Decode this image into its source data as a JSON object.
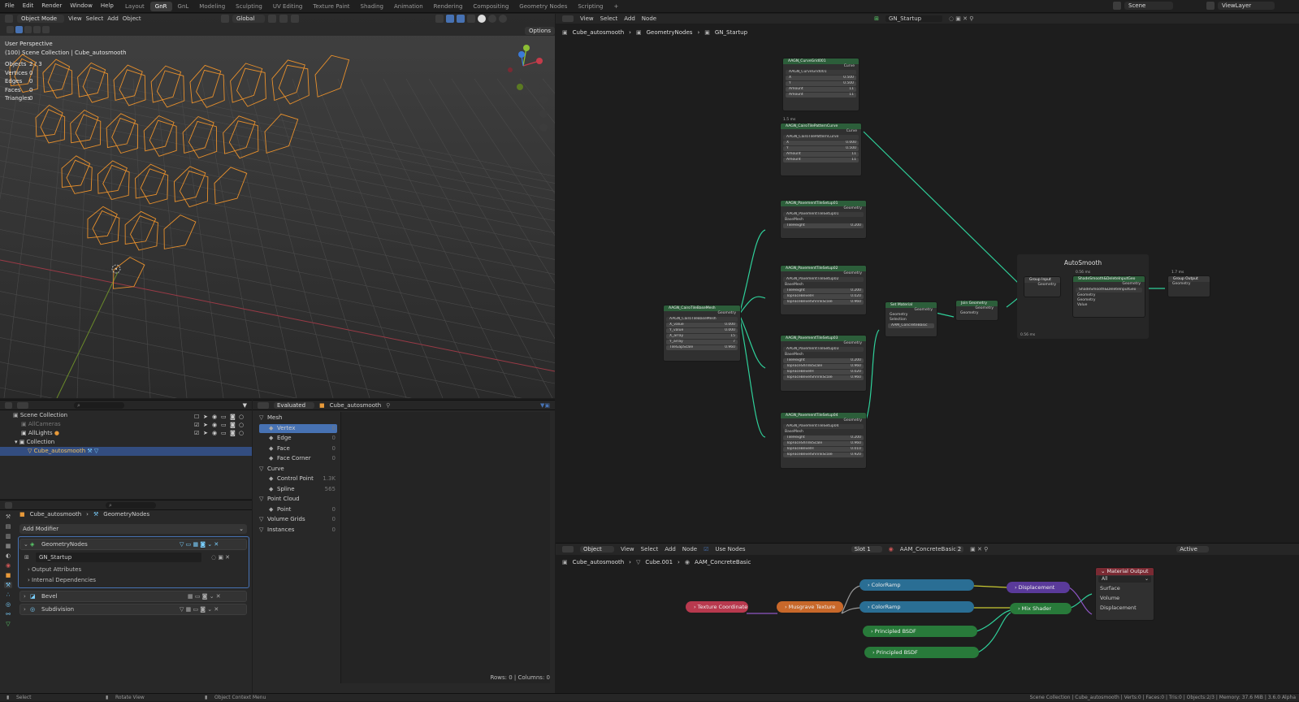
{
  "topbar": {
    "menus": [
      "File",
      "Edit",
      "Render",
      "Window",
      "Help"
    ],
    "workspaces": [
      "Layout",
      "GnR",
      "GnL",
      "Modeling",
      "Sculpting",
      "UV Editing",
      "Texture Paint",
      "Shading",
      "Animation",
      "Rendering",
      "Compositing",
      "Geometry Nodes",
      "Scripting",
      "+"
    ],
    "active_workspace": "GnR",
    "scene": "Scene",
    "view_layer": "ViewLayer"
  },
  "viewport": {
    "mode": "Object Mode",
    "menus": [
      "View",
      "Select",
      "Add",
      "Object"
    ],
    "transform": "Global",
    "options_label": "Options",
    "perspective": "User Perspective",
    "collection_line": "(100) Scene Collection | Cube_autosmooth",
    "stats": [
      {
        "label": "Objects",
        "value": "2 / 3"
      },
      {
        "label": "Vertices",
        "value": "0"
      },
      {
        "label": "Edges",
        "value": "0"
      },
      {
        "label": "Faces",
        "value": "0"
      },
      {
        "label": "Triangles",
        "value": "0"
      }
    ],
    "mesh_color": "#e8902c"
  },
  "outliner": {
    "items": [
      {
        "label": "Scene Collection",
        "indent": 0
      },
      {
        "label": "AllCameras",
        "indent": 1
      },
      {
        "label": "AllLights",
        "indent": 1
      },
      {
        "label": "Collection",
        "indent": 1
      },
      {
        "label": "Cube_autosmooth",
        "indent": 2
      }
    ]
  },
  "properties": {
    "breadcrumb": [
      "Cube_autosmooth",
      "GeometryNodes"
    ],
    "add_modifier": "Add Modifier",
    "modifiers": [
      {
        "name": "GeometryNodes",
        "node_group": "GN_Startup",
        "subitems": [
          "Output Attributes",
          "Internal Dependencies"
        ]
      },
      {
        "name": "Bevel"
      },
      {
        "name": "Subdivision"
      }
    ]
  },
  "spreadsheet": {
    "mode": "Evaluated",
    "object": "Cube_autosmooth",
    "rows": [
      {
        "label": "Mesh",
        "count": "",
        "group": true
      },
      {
        "label": "Vertex",
        "count": "0",
        "group": false,
        "active": true
      },
      {
        "label": "Edge",
        "count": "0",
        "group": false
      },
      {
        "label": "Face",
        "count": "0",
        "group": false
      },
      {
        "label": "Face Corner",
        "count": "0",
        "group": false
      },
      {
        "label": "Curve",
        "count": "",
        "group": true
      },
      {
        "label": "Control Point",
        "count": "1.3K",
        "group": false
      },
      {
        "label": "Spline",
        "count": "565",
        "group": false
      },
      {
        "label": "Point Cloud",
        "count": "",
        "group": true
      },
      {
        "label": "Point",
        "count": "0",
        "group": false
      },
      {
        "label": "Volume Grids",
        "count": "0",
        "group": true
      },
      {
        "label": "Instances",
        "count": "0",
        "group": true
      }
    ],
    "footer": "Rows: 0   |   Columns: 0"
  },
  "geo_editor": {
    "menus": [
      "View",
      "Select",
      "Add",
      "Node"
    ],
    "node_group": "GN_Startup",
    "breadcrumb": [
      "Cube_autosmooth",
      "GeometryNodes",
      "GN_Startup"
    ],
    "frame_label": "AutoSmooth",
    "nodes": {
      "curvegrid": {
        "title": "AAGN_CurveGrid001",
        "out": "Curve",
        "sub": "AAGN_CurveGrid001",
        "fields": [
          [
            "X",
            "0.500"
          ],
          [
            "Y",
            "0.500"
          ],
          [
            "Amount",
            "11"
          ],
          [
            "Amount",
            "11"
          ]
        ]
      },
      "cairo_curve": {
        "title": "AAGN_CairoTilePatternCurve",
        "time": "1.5 ms",
        "out": "Curve",
        "sub": "AAGN_CairoTilePatternCurve",
        "fields": [
          [
            "X",
            "0.000"
          ],
          [
            "Y",
            "0.500"
          ],
          [
            "Amount",
            "11"
          ],
          [
            "Amount",
            "11"
          ]
        ]
      },
      "pav1": {
        "title": "AAGN_PavementTileSetup01",
        "out": "Geometry",
        "sub": "AAGN_PavementTileSetup01",
        "in": "BaseMesh",
        "fields": [
          [
            "TileHeight",
            "0.200"
          ]
        ]
      },
      "pav2": {
        "title": "AAGN_PavementTileSetup02",
        "out": "Geometry",
        "sub": "AAGN_PavementTileSetup02",
        "in": "BaseMesh",
        "fields": [
          [
            "TileHeight",
            "0.200"
          ],
          [
            "TopFaceBevelH",
            "0.020"
          ],
          [
            "TopFaceBevelShrinkScale",
            "0.960"
          ]
        ]
      },
      "pav3": {
        "title": "AAGN_PavementTileSetup03",
        "out": "Geometry",
        "sub": "AAGN_PavementTileSetup03",
        "in": "BaseMesh",
        "fields": [
          [
            "TileHeight",
            "0.200"
          ],
          [
            "TopFaceShrinkScale",
            "0.960"
          ],
          [
            "TopFaceBevelH",
            "0.020"
          ],
          [
            "TopFaceBevelShrinkScale",
            "0.960"
          ]
        ]
      },
      "pav4": {
        "title": "AAGN_PavementTileSetup04",
        "out": "Geometry",
        "sub": "AAGN_PavementTileSetup04",
        "in": "BaseMesh",
        "fields": [
          [
            "TileHeight",
            "0.200"
          ],
          [
            "TopFaceShrinkScale",
            "0.960"
          ],
          [
            "TopFaceBevelH",
            "0.010"
          ],
          [
            "TopFaceBevelShrinkScale",
            "0.920"
          ]
        ]
      },
      "basemesh": {
        "title": "AAGN_CairoTileBaseMesh",
        "out": "Geometry",
        "sub": "AAGN_CairoTileBaseMesh",
        "fields": [
          [
            "X_value",
            "0.000"
          ],
          [
            "Y_value",
            "0.000"
          ],
          [
            "X_array",
            "15"
          ],
          [
            "Y_array",
            "7"
          ],
          [
            "TileGapScale",
            "0.960"
          ]
        ]
      },
      "setmat": {
        "title": "Set Material",
        "in": [
          "Geometry",
          "Selection"
        ],
        "out": "Geometry",
        "material": "AAM_ConcreteBasic"
      },
      "join": {
        "title": "Join Geometry",
        "in": "Geometry",
        "out": "Geometry"
      },
      "group_in": {
        "title": "Group Input",
        "out": "Geometry"
      },
      "shade": {
        "title": "ShadeSmooth&DeleteInputGeo",
        "time": "0.56 ms",
        "sub": "ShadeSmooth&DeleteInputGeo",
        "in": [
          "Geometry",
          "Geometry",
          "Value"
        ],
        "out": "Geometry"
      },
      "group_out": {
        "title": "Group Output",
        "time": "1.7 ms",
        "in": "Geometry"
      },
      "frame_time": "0.56 ms"
    }
  },
  "mat_editor": {
    "object_mode": "Object",
    "menus": [
      "View",
      "Select",
      "Add",
      "Node"
    ],
    "use_nodes": "Use Nodes",
    "slot": "Slot 1",
    "material": "AAM_ConcreteBasic",
    "users": "2",
    "view": "Active",
    "breadcrumb": [
      "Cube_autosmooth",
      "Cube.001",
      "AAM_ConcreteBasic"
    ],
    "nodes": {
      "texcoord": "Texture Coordinate",
      "musgrave": "Musgrave Texture",
      "ramp1": "ColorRamp",
      "ramp2": "ColorRamp",
      "bsdf1": "Principled BSDF",
      "bsdf2": "Principled BSDF",
      "displacement": "Displacement",
      "mix": "Mix Shader",
      "output": "Material Output",
      "output_target": "All",
      "output_sockets": [
        "Surface",
        "Volume",
        "Displacement"
      ]
    }
  },
  "statusbar": {
    "left": [
      "Select",
      "Rotate View",
      "Object Context Menu"
    ],
    "right": "Scene Collection | Cube_autosmooth | Verts:0 | Faces:0 | Tris:0 | Objects:2/3 | Memory: 37.6 MiB | 3.6.0 Alpha"
  },
  "colors": {
    "accent": "#4772b3",
    "link": "#2fd09a",
    "wire": "#e8902c"
  }
}
